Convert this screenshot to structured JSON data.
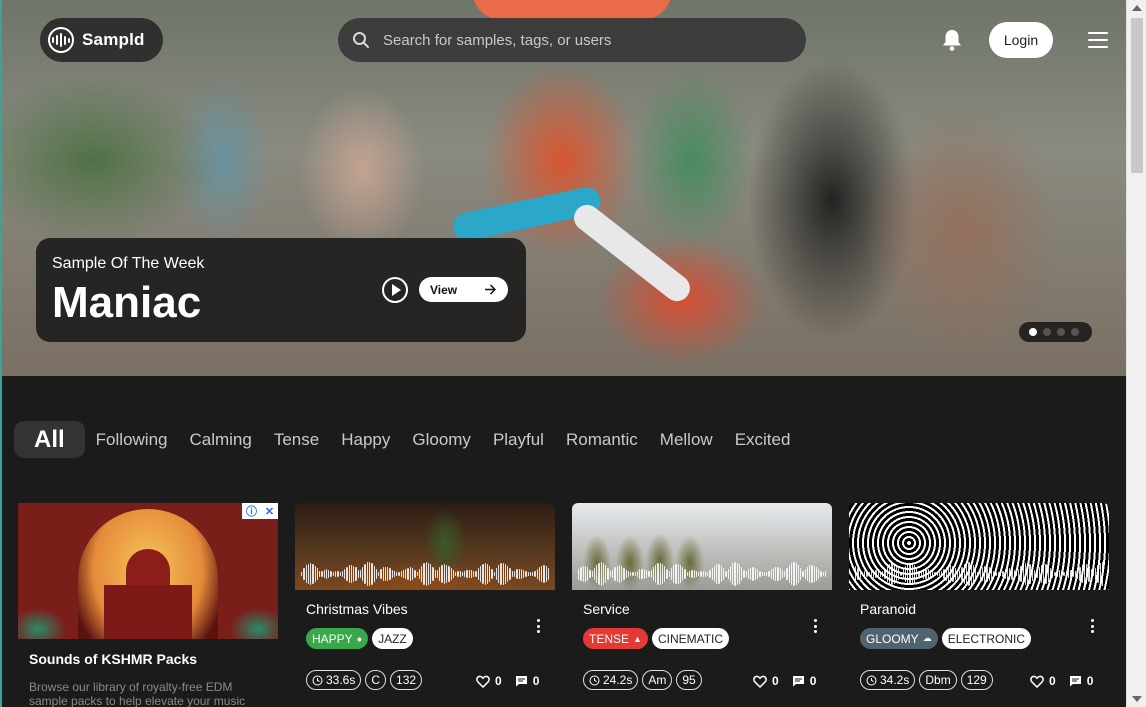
{
  "header": {
    "logo_text": "Sampld",
    "search_placeholder": "Search for samples, tags, or users",
    "login_label": "Login"
  },
  "hero": {
    "label": "Sample Of The Week",
    "title": "Maniac",
    "view_label": "View",
    "carousel": {
      "count": 4,
      "active": 1
    }
  },
  "filters": [
    "All",
    "Following",
    "Calming",
    "Tense",
    "Happy",
    "Gloomy",
    "Playful",
    "Romantic",
    "Mellow",
    "Excited"
  ],
  "ad": {
    "title": "Sounds of KSHMR Packs",
    "description": "Browse our library of royalty-free EDM sample packs to help elevate your music"
  },
  "samples": [
    {
      "title": "Christmas Vibes",
      "mood": "HAPPY",
      "mood_icon": "circle-icon",
      "mood_color": "#3aa84a",
      "genre": "JAZZ",
      "duration": "33.6s",
      "key": "C",
      "bpm": "132",
      "likes": "0",
      "comments": "0"
    },
    {
      "title": "Service",
      "mood": "TENSE",
      "mood_icon": "flame-icon",
      "mood_color": "#e53935",
      "genre": "CINEMATIC",
      "duration": "24.2s",
      "key": "Am",
      "bpm": "95",
      "likes": "0",
      "comments": "0"
    },
    {
      "title": "Paranoid",
      "mood": "GLOOMY",
      "mood_icon": "cloud-icon",
      "mood_color": "#4f6470",
      "genre": "ELECTRONIC",
      "duration": "34.2s",
      "key": "Dbm",
      "bpm": "129",
      "likes": "0",
      "comments": "0"
    }
  ]
}
